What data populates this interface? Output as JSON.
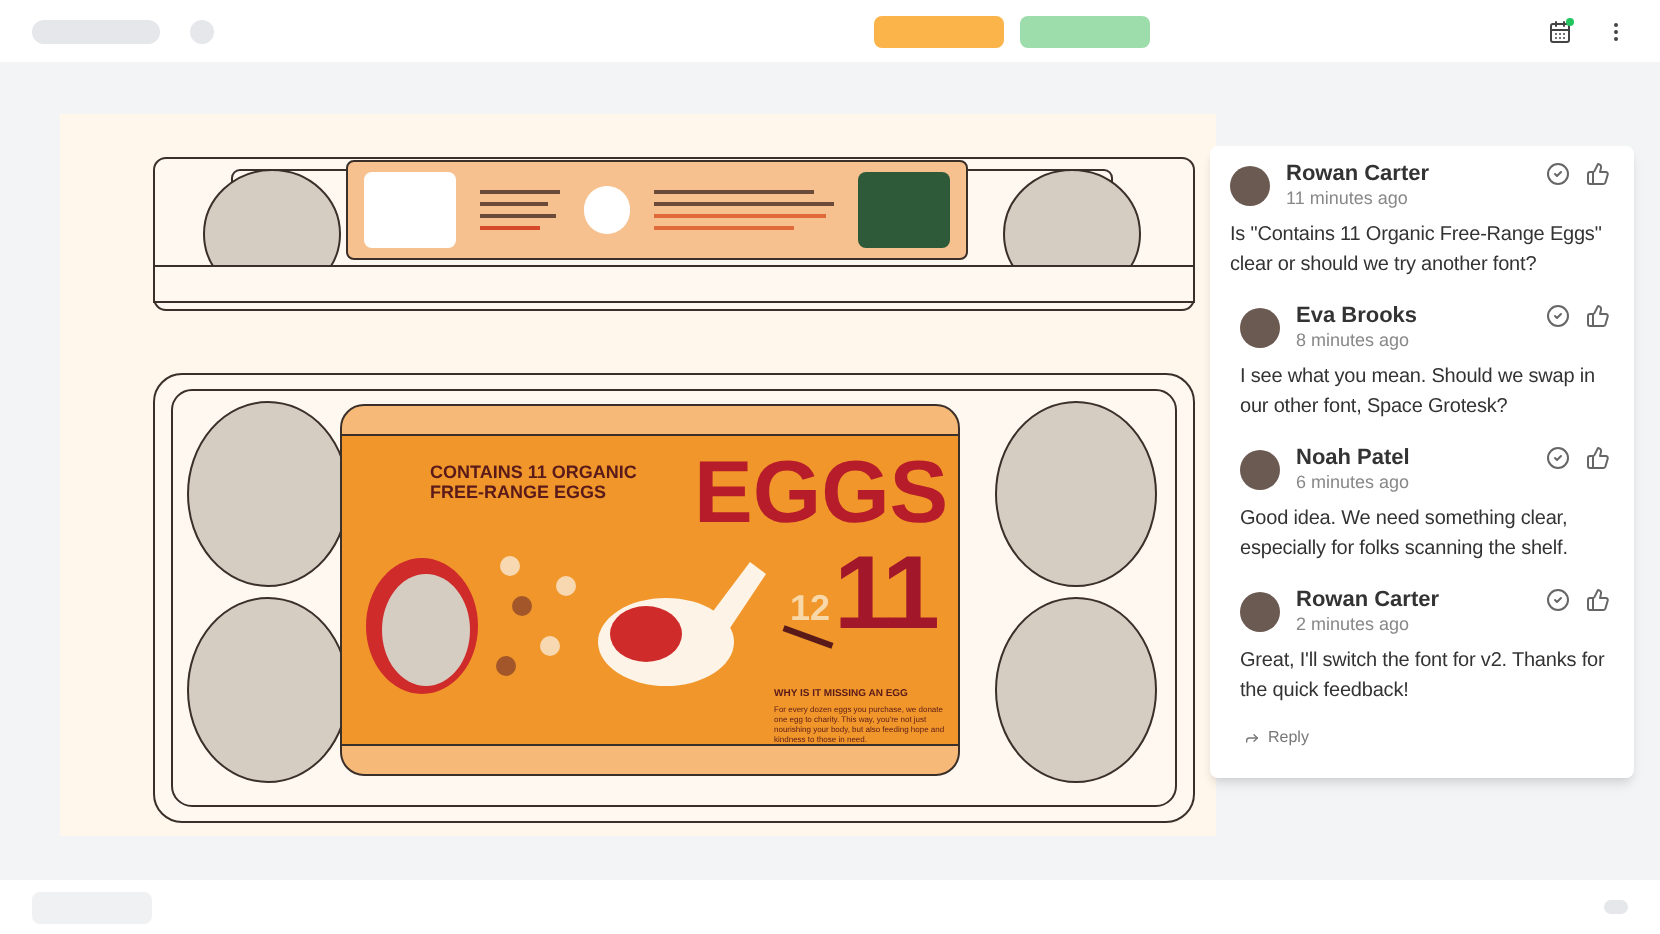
{
  "artwork": {
    "headline": [
      "CONTAINS 11 ORGANIC",
      "FREE-RANGE EGGS"
    ],
    "title": "EGGS",
    "count": "11",
    "crossed_count": "12",
    "subheading": "WHY IS IT MISSING AN EGG",
    "body": "For every dozen eggs you purchase, we donate one egg to charity. This way, you're not just nourishing your body, but also feeding hope and kindness to those in need."
  },
  "comments": [
    {
      "kind": "thread",
      "author": "Rowan Carter",
      "time": "11 minutes ago",
      "text": "Is \"Contains 11 Organic Free-Range Eggs\" clear or should we try another font?"
    },
    {
      "kind": "reply",
      "author": "Eva Brooks",
      "time": "8 minutes ago",
      "text": "I see what you mean. Should we swap in our other font, Space Grotesk?"
    },
    {
      "kind": "reply",
      "author": "Noah Patel",
      "time": "6 minutes ago",
      "text": "Good idea. We need something clear, especially for folks scanning the shelf."
    },
    {
      "kind": "reply",
      "author": "Rowan Carter",
      "time": "2 minutes ago",
      "text": "Great, I'll switch the font for v2. Thanks for the quick feedback!"
    }
  ],
  "reply_link": "Reply"
}
